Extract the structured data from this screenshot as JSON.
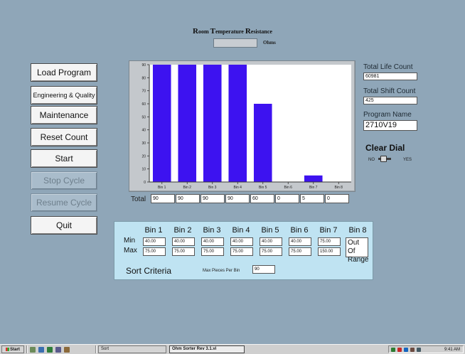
{
  "header": {
    "title_parts": [
      {
        "cap": "R",
        "rest": "oom "
      },
      {
        "cap": "T",
        "rest": "emperature "
      },
      {
        "cap": "R",
        "rest": "esistance"
      }
    ],
    "resistance_value": "",
    "resistance_unit": "Ohms"
  },
  "buttons": [
    {
      "label": "Load Program",
      "enabled": true
    },
    {
      "label": "Engineering & Quality",
      "enabled": true
    },
    {
      "label": "Maintenance",
      "enabled": true
    },
    {
      "label": "Reset Count",
      "enabled": true
    },
    {
      "label": "Start",
      "enabled": true
    },
    {
      "label": "Stop Cycle",
      "enabled": false
    },
    {
      "label": "Resume Cycle",
      "enabled": false
    },
    {
      "label": "Quit",
      "enabled": true
    }
  ],
  "chart_data": {
    "type": "bar",
    "categories": [
      "Bin 1",
      "Bin 2",
      "Bin 3",
      "Bin 4",
      "Bin 5",
      "Bin 6",
      "Bin 7",
      "Bin 8"
    ],
    "values": [
      90,
      90,
      90,
      90,
      60,
      0,
      5,
      0
    ],
    "ylim": [
      0,
      90
    ],
    "yticks": [
      0,
      10,
      20,
      30,
      40,
      50,
      60,
      70,
      80,
      90
    ],
    "bar_color": "#3d12f0",
    "plot_bg": "#ffffff",
    "grid": false
  },
  "totals": {
    "label": "Total",
    "values": [
      "90",
      "90",
      "90",
      "90",
      "60",
      "0",
      "5",
      "0"
    ]
  },
  "right_panel": {
    "life_count_label": "Total Life Count",
    "life_count_value": "60981",
    "shift_count_label": "Total Shift Count",
    "shift_count_value": "425",
    "program_name_label": "Program Name",
    "program_name_value": "2710V19",
    "clear_dial_label": "Clear Dial",
    "no_label": "NO",
    "yes_label": "YES"
  },
  "sort_criteria": {
    "bin_headers": [
      "Bin 1",
      "Bin 2",
      "Bin 3",
      "Bin 4",
      "Bin 5",
      "Bin 6",
      "Bin 7",
      "Bin 8"
    ],
    "min_label": "Min",
    "max_label": "Max",
    "min_values": [
      "40.00",
      "40.00",
      "40.00",
      "40.00",
      "40.00",
      "40.00",
      "75.00"
    ],
    "max_values": [
      "75.00",
      "75.00",
      "75.00",
      "75.00",
      "75.00",
      "75.00",
      "150.00"
    ],
    "out_of_range": "Out Of Range",
    "title": "Sort Criteria",
    "max_pieces_label": "Max Pieces Per Bin",
    "max_pieces_value": "90"
  },
  "taskbar": {
    "start_label": "Start",
    "items": [
      {
        "label": "Sort",
        "active": false
      },
      {
        "label": "Ohm Sorter Rev 3.1.vi",
        "active": true
      }
    ],
    "clock": "9:41 AM"
  }
}
